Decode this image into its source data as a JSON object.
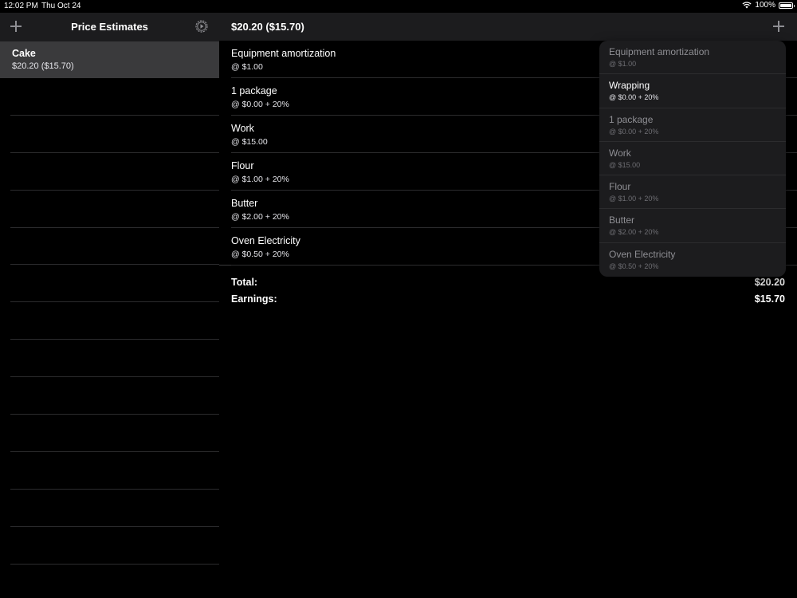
{
  "status_bar": {
    "time": "12:02 PM",
    "date": "Thu Oct 24",
    "battery": "100%",
    "battery_level": 1.0
  },
  "sidebar": {
    "title": "Price Estimates",
    "selected": {
      "name": "Cake",
      "summary": "$20.20 ($15.70)"
    }
  },
  "main": {
    "title": "$20.20 ($15.70)",
    "items": [
      {
        "name": "Equipment amortization",
        "price": "@ $1.00"
      },
      {
        "name": "1 package",
        "price": "@ $0.00 + 20%"
      },
      {
        "name": "Work",
        "price": "@ $15.00"
      },
      {
        "name": "Flour",
        "price": "@ $1.00 + 20%"
      },
      {
        "name": "Butter",
        "price": "@ $2.00 + 20%"
      },
      {
        "name": "Oven Electricity",
        "price": "@ $0.50 + 20%"
      }
    ],
    "totals": {
      "total_label": "Total:",
      "total_value": "$20.20",
      "earnings_label": "Earnings:",
      "earnings_value": "$15.70"
    }
  },
  "popover": {
    "items": [
      {
        "name": "Equipment amortization",
        "price": "@ $1.00",
        "enabled": false
      },
      {
        "name": "Wrapping",
        "price": "@ $0.00 + 20%",
        "enabled": true
      },
      {
        "name": "1 package",
        "price": "@ $0.00 + 20%",
        "enabled": false
      },
      {
        "name": "Work",
        "price": "@ $15.00",
        "enabled": false
      },
      {
        "name": "Flour",
        "price": "@ $1.00 + 20%",
        "enabled": false
      },
      {
        "name": "Butter",
        "price": "@ $2.00 + 20%",
        "enabled": false
      },
      {
        "name": "Oven Electricity",
        "price": "@ $0.50 + 20%",
        "enabled": false
      }
    ]
  },
  "colors": {
    "background": "#000000",
    "header": "#1c1c1e",
    "selected_row": "#3a3a3c",
    "separator": "#2c2c2e",
    "disabled_text": "#8e8e93"
  },
  "icons": {
    "add": "plus-icon",
    "settings": "gear-icon",
    "wifi": "wifi-icon",
    "battery": "battery-icon"
  }
}
